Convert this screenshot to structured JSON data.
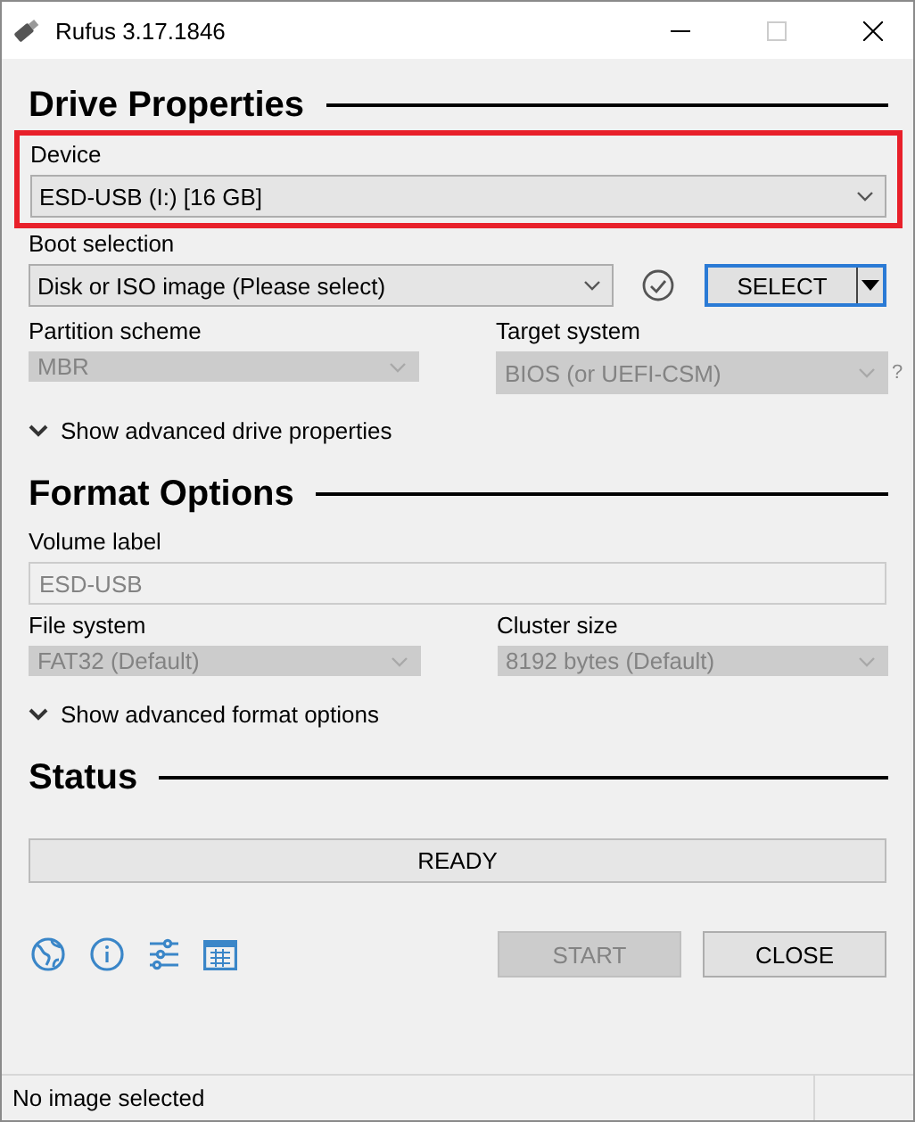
{
  "window": {
    "title": "Rufus 3.17.1846"
  },
  "drive_properties": {
    "title": "Drive Properties",
    "device": {
      "label": "Device",
      "value": "ESD-USB (I:) [16 GB]",
      "highlighted": true
    },
    "boot_selection": {
      "label": "Boot selection",
      "value": "Disk or ISO image (Please select)",
      "button": "SELECT"
    },
    "partition_scheme": {
      "label": "Partition scheme",
      "value": "MBR",
      "disabled": true
    },
    "target_system": {
      "label": "Target system",
      "value": "BIOS (or UEFI-CSM)",
      "disabled": true,
      "help": "?"
    },
    "advanced_toggle": {
      "label": "Show advanced drive properties",
      "expanded": false
    }
  },
  "format_options": {
    "title": "Format Options",
    "volume_label": {
      "label": "Volume label",
      "value": "ESD-USB",
      "disabled": true
    },
    "file_system": {
      "label": "File system",
      "value": "FAT32 (Default)",
      "disabled": true
    },
    "cluster_size": {
      "label": "Cluster size",
      "value": "8192 bytes (Default)",
      "disabled": true
    },
    "advanced_toggle": {
      "label": "Show advanced format options",
      "expanded": false
    }
  },
  "status": {
    "title": "Status",
    "progress": {
      "text": "READY",
      "level": 0
    }
  },
  "buttons": [
    {
      "label": "START",
      "disabled": true
    },
    {
      "label": "CLOSE",
      "disabled": false
    }
  ],
  "status_bar": {
    "text": "No image selected"
  }
}
